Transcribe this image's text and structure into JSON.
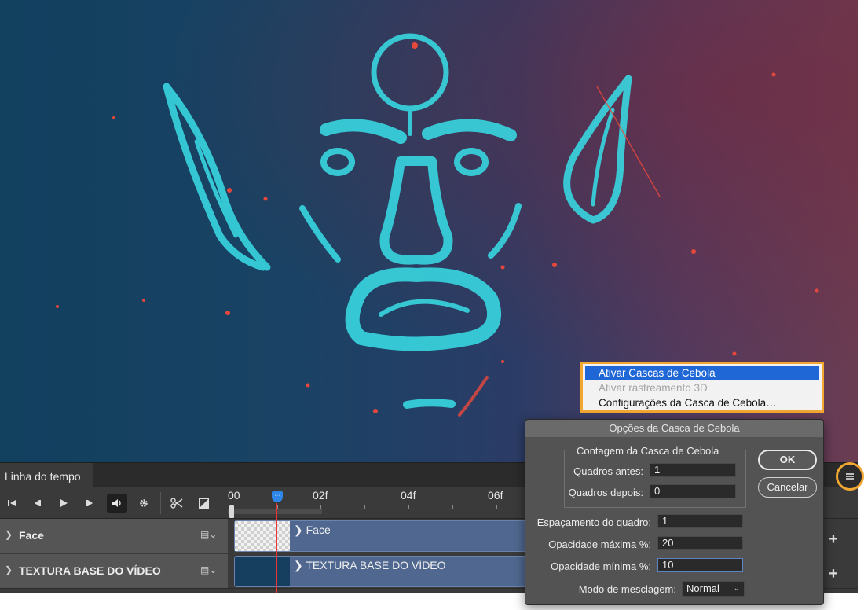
{
  "canvas": {
    "description_colors": {
      "ink": "#38d6e0",
      "speck": "#e8483c",
      "bg_left": "#12405f",
      "bg_right": "#6a3c52"
    }
  },
  "flyout_menu": {
    "items": [
      {
        "label": "Ativar Cascas de Cebola",
        "state": "highlighted"
      },
      {
        "label": "Ativar rastreamento 3D",
        "state": "disabled"
      },
      {
        "label": "Configurações da Casca de Cebola…",
        "state": "enabled"
      }
    ]
  },
  "timeline": {
    "tab_label": "Linha do tempo",
    "ruler": {
      "labels": [
        "00",
        "02f",
        "04f",
        "06f"
      ]
    },
    "layers": [
      {
        "name": "Face",
        "clip_label": "Face"
      },
      {
        "name": "TEXTURA BASE DO VÍDEO",
        "clip_label": "TEXTURA BASE DO VÍDEO"
      }
    ],
    "add_symbol": "+",
    "icons": {
      "go_to_first": "⏮",
      "prev_frame": "◀",
      "play": "▶",
      "next_frame": "▶",
      "audio": "🔈",
      "settings": "⚙",
      "scissors": "✂",
      "transition": "◩"
    }
  },
  "dialog": {
    "title": "Opções da Casca de Cebola",
    "group_title": "Contagem da Casca de Cebola",
    "frames_before_label": "Quadros antes:",
    "frames_before_value": "1",
    "frames_after_label": "Quadros depois:",
    "frames_after_value": "0",
    "frame_spacing_label": "Espaçamento do quadro:",
    "frame_spacing_value": "1",
    "max_opacity_label": "Opacidade máxima %:",
    "max_opacity_value": "20",
    "min_opacity_label": "Opacidade mínima %:",
    "min_opacity_value": "10",
    "blend_mode_label": "Modo de mesclagem:",
    "blend_mode_value": "Normal",
    "ok_label": "OK",
    "cancel_label": "Cancelar"
  }
}
